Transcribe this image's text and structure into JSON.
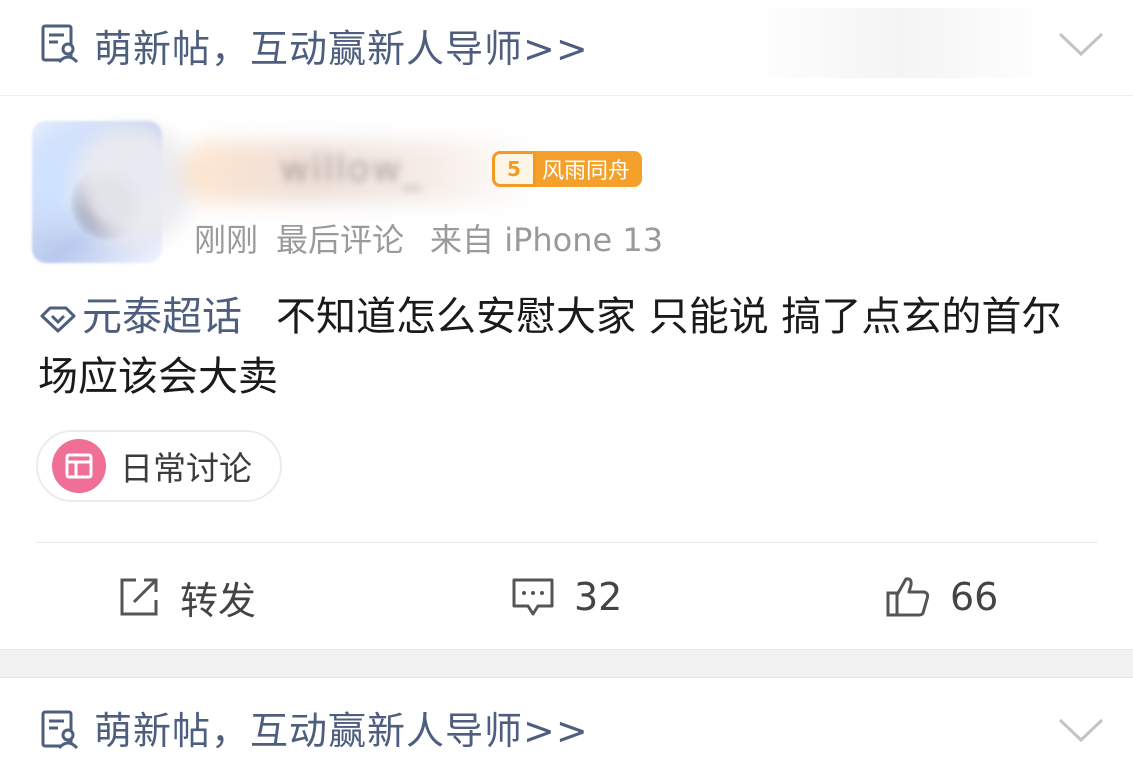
{
  "banner": {
    "text": "萌新帖，互动赢新人导师>>",
    "icon": "document-user-icon",
    "chevron_icon": "chevron-down-icon"
  },
  "post": {
    "username": "willow_",
    "badge": {
      "level": "5",
      "text": "风雨同舟",
      "color": "#f5a02a"
    },
    "meta": {
      "time": "刚刚",
      "last_comment": "最后评论",
      "source": "来自 iPhone 13"
    },
    "topic": "元泰超话",
    "content_text": "不知道怎么安慰大家 只能说 搞了点玄的首尔场应该会大卖",
    "tag": {
      "label": "日常讨论",
      "color": "#ef6f97"
    }
  },
  "actions": {
    "repost_label": "转发",
    "comment_count": "32",
    "like_count": "66"
  },
  "colors": {
    "link_blue": "#4e5e7e",
    "meta_gray": "#9a9a9a"
  }
}
